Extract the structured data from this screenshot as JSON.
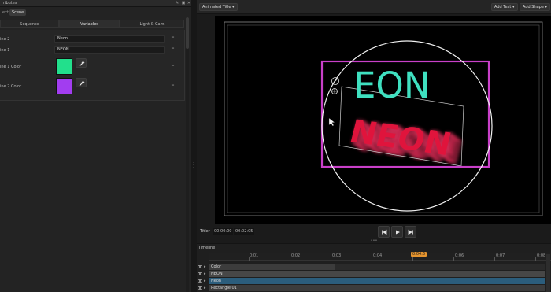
{
  "left_panel": {
    "title": "ributes",
    "top_tabs": [
      {
        "label": "ext"
      },
      {
        "label": "Scene"
      }
    ],
    "subtabs": [
      {
        "label": "Sequence"
      },
      {
        "label": "Variables"
      },
      {
        "label": "Light & Cam"
      }
    ],
    "properties": [
      {
        "label": "ine 2",
        "value": "Neon"
      },
      {
        "label": "ine 1",
        "value": "NEON"
      },
      {
        "label": "ine 1 Color",
        "color": "#22e08c"
      },
      {
        "label": "ine 2 Color",
        "color": "#a23df0"
      }
    ]
  },
  "toolbar": {
    "animated_title": "Animated Title",
    "add_text": "Add Text",
    "add_shape": "Add Shape"
  },
  "preview": {
    "eon_text": "EON",
    "eon_color": "#3fe0c0",
    "neon_color": "#e0143c",
    "selection_color": "#c940c9"
  },
  "transport": {
    "label": "Titler",
    "current_time": "00:00:00",
    "duration": "00:02:05"
  },
  "timeline": {
    "title": "Timeline",
    "ruler_labels": [
      "0:01",
      "0:02",
      "0:03",
      "0:04",
      "0:05",
      "0:06",
      "0:07",
      "0:08"
    ],
    "playhead": "0:04:6",
    "tracks": [
      {
        "label": "Color"
      },
      {
        "label": "NEON"
      },
      {
        "label": "Neon"
      },
      {
        "label": "Rectangle 01"
      }
    ]
  }
}
